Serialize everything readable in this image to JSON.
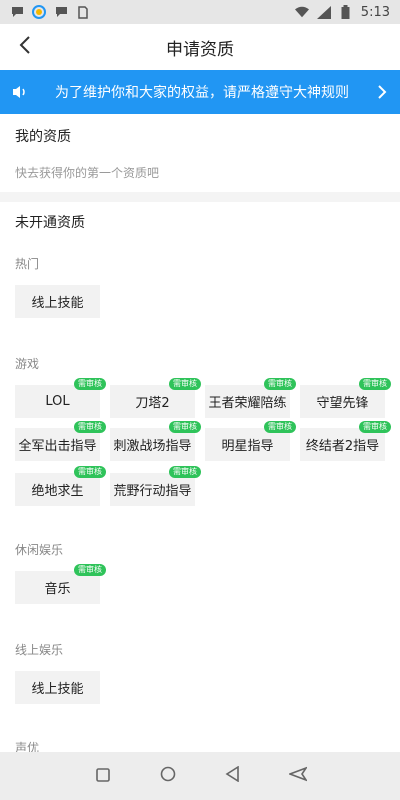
{
  "status_bar": {
    "time": "5:13"
  },
  "header": {
    "title": "申请资质"
  },
  "banner": {
    "text": "为了维护你和大家的权益，请严格遵守大神规则"
  },
  "my_section": {
    "title": "我的资质",
    "hint": "快去获得你的第一个资质吧"
  },
  "unopened_section": {
    "title": "未开通资质"
  },
  "badge_text": "需审核",
  "categories": [
    {
      "label": "热门",
      "tags": [
        {
          "label": "线上技能",
          "badge": false
        }
      ]
    },
    {
      "label": "游戏",
      "tags": [
        {
          "label": "LOL",
          "badge": true
        },
        {
          "label": "刀塔2",
          "badge": true
        },
        {
          "label": "王者荣耀陪练",
          "badge": true
        },
        {
          "label": "守望先锋",
          "badge": true
        },
        {
          "label": "全军出击指导",
          "badge": true
        },
        {
          "label": "刺激战场指导",
          "badge": true
        },
        {
          "label": "明星指导",
          "badge": true
        },
        {
          "label": "终结者2指导",
          "badge": true
        },
        {
          "label": "绝地求生",
          "badge": true
        },
        {
          "label": "荒野行动指导",
          "badge": true
        }
      ]
    },
    {
      "label": "休闲娱乐",
      "tags": [
        {
          "label": "音乐",
          "badge": true
        }
      ]
    },
    {
      "label": "线上娱乐",
      "tags": [
        {
          "label": "线上技能",
          "badge": false
        }
      ]
    },
    {
      "label": "声优",
      "tags": []
    }
  ],
  "colors": {
    "banner": "#2196f3",
    "badge": "#2fc35a",
    "tag_bg": "#f2f2f2"
  }
}
